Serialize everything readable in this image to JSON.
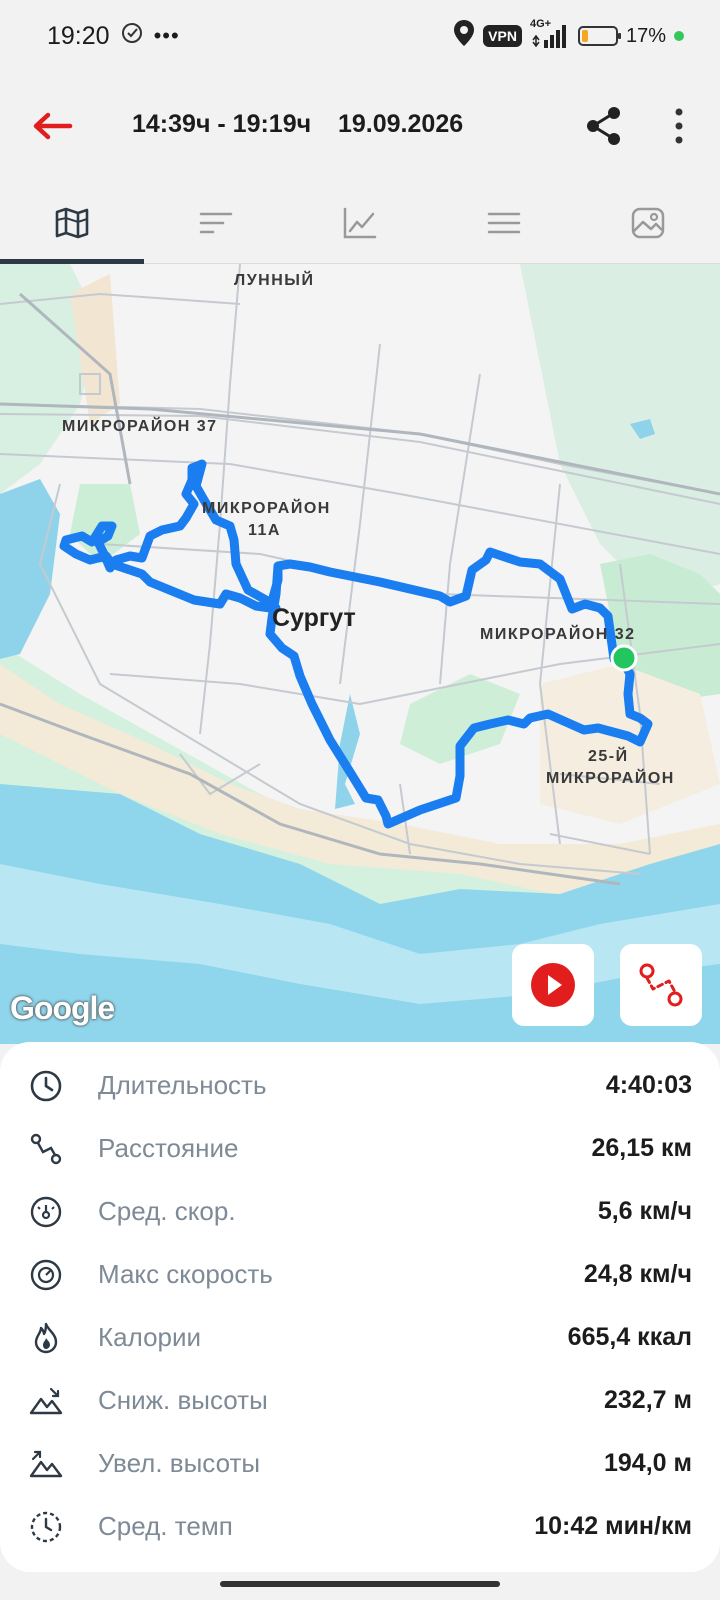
{
  "status_bar": {
    "time": "19:20",
    "vpn": "VPN",
    "network": "4G+",
    "battery_percent": "17%"
  },
  "header": {
    "time_range": "14:39ч - 19:19ч",
    "date": "19.09.2026"
  },
  "tabs": [
    {
      "icon": "map-icon",
      "active": true
    },
    {
      "icon": "sort-icon",
      "active": false
    },
    {
      "icon": "chart-icon",
      "active": false
    },
    {
      "icon": "list-icon",
      "active": false
    },
    {
      "icon": "image-icon",
      "active": false
    }
  ],
  "map": {
    "labels": {
      "lunny": "ЛУННЫЙ",
      "mkr37": "МИКРОРАЙОН 37",
      "mkr11a_line1": "МИКРОРАЙОН",
      "mkr11a_line2": "11А",
      "city": "Сургут",
      "mkr32": "МИКРОРАЙОН 32",
      "mkr25_line1": "25-Й",
      "mkr25_line2": "МИКРОРАЙОН"
    },
    "attribution": "Google",
    "route_color": "#1a7ef0",
    "start_marker_color": "#22c55e"
  },
  "stats": [
    {
      "icon": "clock-icon",
      "label": "Длительность",
      "value": "4:40:03"
    },
    {
      "icon": "route-icon",
      "label": "Расстояние",
      "value": "26,15 км"
    },
    {
      "icon": "speedometer-icon",
      "label": "Сред. скор.",
      "value": "5,6 км/ч"
    },
    {
      "icon": "max-speed-icon",
      "label": "Макс скорость",
      "value": "24,8 км/ч"
    },
    {
      "icon": "flame-icon",
      "label": "Калории",
      "value": "665,4 ккал"
    },
    {
      "icon": "descent-icon",
      "label": "Сниж. высоты",
      "value": "232,7 м"
    },
    {
      "icon": "ascent-icon",
      "label": "Увел. высоты",
      "value": "194,0 м"
    },
    {
      "icon": "pace-icon",
      "label": "Сред. темп",
      "value": "10:42 мин/км"
    }
  ]
}
